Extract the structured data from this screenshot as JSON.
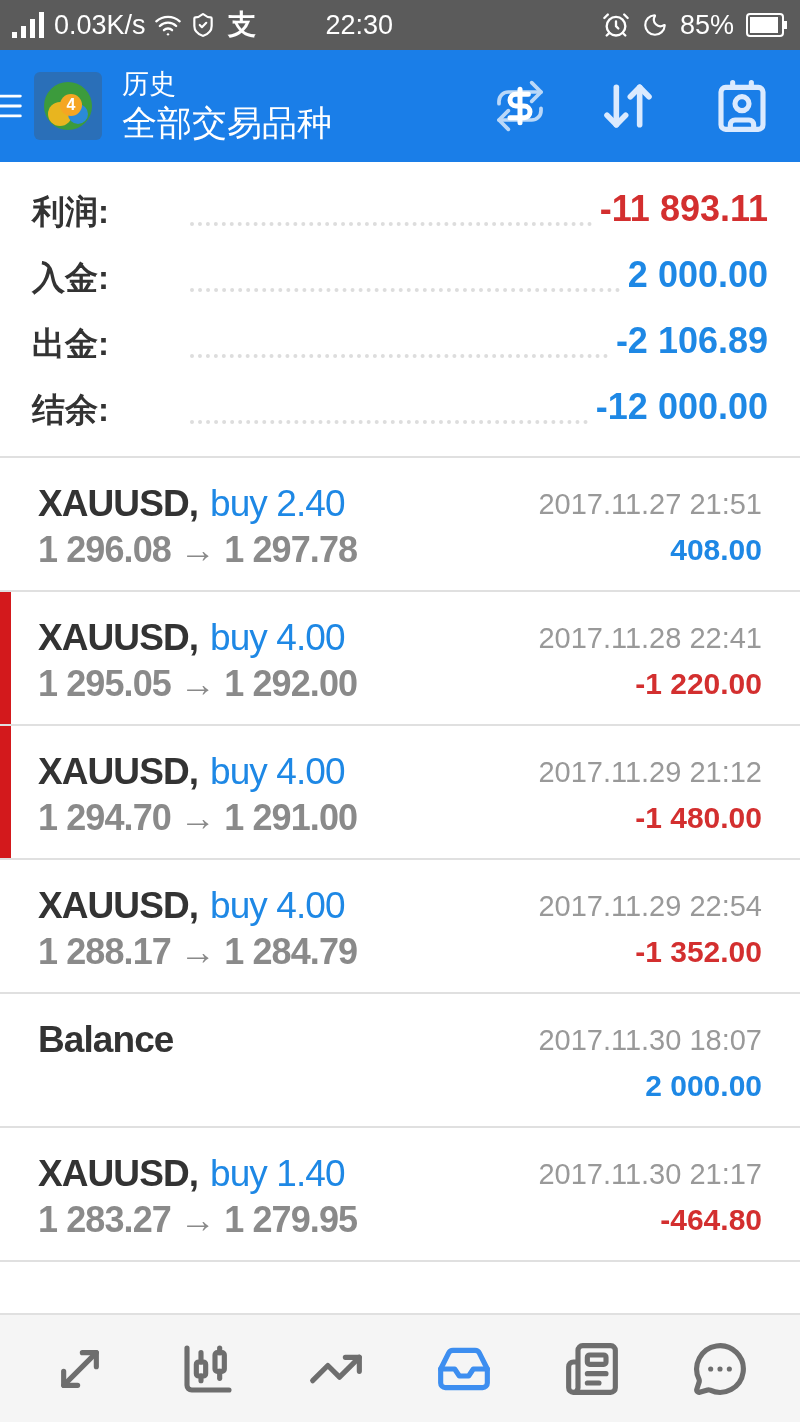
{
  "status_bar": {
    "speed": "0.03K/s",
    "alipay": "支",
    "time": "22:30",
    "battery": "85%"
  },
  "header": {
    "logo_badge": "4",
    "title": "历史",
    "subtitle": "全部交易品种"
  },
  "summary": [
    {
      "label": "利润:",
      "value": "-11 893.11",
      "negative": true
    },
    {
      "label": "入金:",
      "value": "2 000.00",
      "negative": false
    },
    {
      "label": "出金:",
      "value": "-2 106.89",
      "negative": false
    },
    {
      "label": "结余:",
      "value": "-12 000.00",
      "negative": false
    }
  ],
  "rows": [
    {
      "kind": "trade",
      "symbol": "XAUUSD,",
      "sell": false,
      "type_text": "buy 2.40",
      "prices": "1 296.08 → 1 297.78",
      "time": "2017.11.27 21:51",
      "profit": "408.00",
      "loss": false,
      "marked": false
    },
    {
      "kind": "trade",
      "symbol": "XAUUSD,",
      "sell": false,
      "type_text": "buy 4.00",
      "prices": "1 295.05 → 1 292.00",
      "time": "2017.11.28 22:41",
      "profit": "-1 220.00",
      "loss": true,
      "marked": true
    },
    {
      "kind": "trade",
      "symbol": "XAUUSD,",
      "sell": false,
      "type_text": "buy 4.00",
      "prices": "1 294.70 → 1 291.00",
      "time": "2017.11.29 21:12",
      "profit": "-1 480.00",
      "loss": true,
      "marked": true
    },
    {
      "kind": "trade",
      "symbol": "XAUUSD,",
      "sell": false,
      "type_text": "buy 4.00",
      "prices": "1 288.17 → 1 284.79",
      "time": "2017.11.29 22:54",
      "profit": "-1 352.00",
      "loss": true,
      "marked": false
    },
    {
      "kind": "balance",
      "symbol": "Balance",
      "time": "2017.11.30 18:07",
      "profit": "2 000.00",
      "loss": false,
      "marked": false
    },
    {
      "kind": "trade",
      "symbol": "XAUUSD,",
      "sell": false,
      "type_text": "buy 1.40",
      "prices": "1 283.27 → 1 279.95",
      "time": "2017.11.30 21:17",
      "profit": "-464.80",
      "loss": true,
      "marked": false
    }
  ],
  "nav": [
    {
      "selected": false
    },
    {
      "selected": false
    },
    {
      "selected": false
    },
    {
      "selected": true
    },
    {
      "selected": false
    },
    {
      "selected": false
    }
  ]
}
